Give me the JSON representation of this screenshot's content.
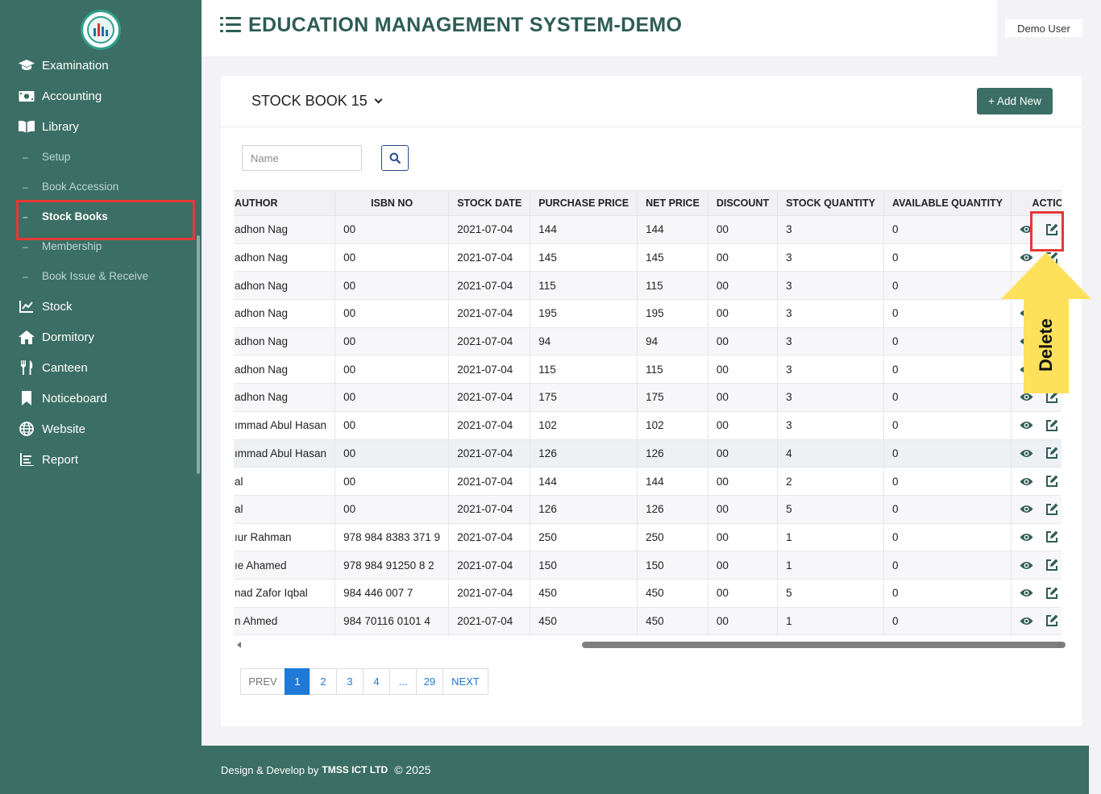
{
  "app": {
    "title": "EDUCATION MANAGEMENT SYSTEM-DEMO",
    "user": "Demo User"
  },
  "sidebar": {
    "items_top": [
      {
        "label": "Examination",
        "icon": "graduation-cap-icon"
      },
      {
        "label": "Accounting",
        "icon": "money-icon"
      },
      {
        "label": "Library",
        "icon": "book-open-icon"
      }
    ],
    "library_sub": [
      "Setup",
      "Book Accession",
      "Stock Books",
      "Membership",
      "Book Issue & Receive"
    ],
    "items_bottom": [
      {
        "label": "Stock",
        "icon": "chart-line-icon"
      },
      {
        "label": "Dormitory",
        "icon": "home-icon"
      },
      {
        "label": "Canteen",
        "icon": "utensils-icon"
      },
      {
        "label": "Noticeboard",
        "icon": "bookmark-icon"
      },
      {
        "label": "Website",
        "icon": "globe-icon"
      },
      {
        "label": "Report",
        "icon": "report-list-icon"
      }
    ]
  },
  "card": {
    "selected_book": "STOCK BOOK 15",
    "add_button": "+ Add New",
    "search_placeholder": "Name"
  },
  "table": {
    "headers": [
      "AUTHOR",
      "ISBN NO",
      "STOCK DATE",
      "PURCHASE PRICE",
      "NET PRICE",
      "DISCOUNT",
      "STOCK QUANTITY",
      "AVAILABLE QUANTITY",
      "ACTION"
    ],
    "rows": [
      [
        "adhon Nag",
        "00",
        "2021-07-04",
        "144",
        "144",
        "00",
        "3",
        "0"
      ],
      [
        "adhon Nag",
        "00",
        "2021-07-04",
        "145",
        "145",
        "00",
        "3",
        "0"
      ],
      [
        "adhon Nag",
        "00",
        "2021-07-04",
        "115",
        "115",
        "00",
        "3",
        "0"
      ],
      [
        "adhon Nag",
        "00",
        "2021-07-04",
        "195",
        "195",
        "00",
        "3",
        "0"
      ],
      [
        "adhon Nag",
        "00",
        "2021-07-04",
        "94",
        "94",
        "00",
        "3",
        "0"
      ],
      [
        "adhon Nag",
        "00",
        "2021-07-04",
        "115",
        "115",
        "00",
        "3",
        "0"
      ],
      [
        "adhon Nag",
        "00",
        "2021-07-04",
        "175",
        "175",
        "00",
        "3",
        "0"
      ],
      [
        "ımmad Abul Hasan",
        "00",
        "2021-07-04",
        "102",
        "102",
        "00",
        "3",
        "0"
      ],
      [
        "ımmad Abul Hasan",
        "00",
        "2021-07-04",
        "126",
        "126",
        "00",
        "4",
        "0"
      ],
      [
        "al",
        "00",
        "2021-07-04",
        "144",
        "144",
        "00",
        "2",
        "0"
      ],
      [
        "al",
        "00",
        "2021-07-04",
        "126",
        "126",
        "00",
        "5",
        "0"
      ],
      [
        "ıur Rahman",
        "978 984 8383 371 9",
        "2021-07-04",
        "250",
        "250",
        "00",
        "1",
        "0"
      ],
      [
        "ıe Ahamed",
        "978 984 91250 8 2",
        "2021-07-04",
        "150",
        "150",
        "00",
        "1",
        "0"
      ],
      [
        "nad Zafor Iqbal",
        "984 446 007 7",
        "2021-07-04",
        "450",
        "450",
        "00",
        "5",
        "0"
      ],
      [
        "n Ahmed",
        "984 70116 0101 4",
        "2021-07-04",
        "450",
        "450",
        "00",
        "1",
        "0"
      ]
    ]
  },
  "pagination": {
    "prev": "PREV",
    "pages": [
      "1",
      "2",
      "3",
      "4",
      "...",
      "29"
    ],
    "current": "1",
    "next": "NEXT"
  },
  "annotation": {
    "label": "Delete",
    "arrow_color": "#fde15b",
    "highlight_color": "#e53935"
  },
  "footer": {
    "prefix": "Design & Develop by",
    "company": "TMSS ICT LTD",
    "copyright": "© 2025"
  },
  "colors": {
    "primary": "#3b6e64",
    "title": "#2e5d54",
    "link": "#1e7ad6",
    "delete": "#e8533a"
  }
}
